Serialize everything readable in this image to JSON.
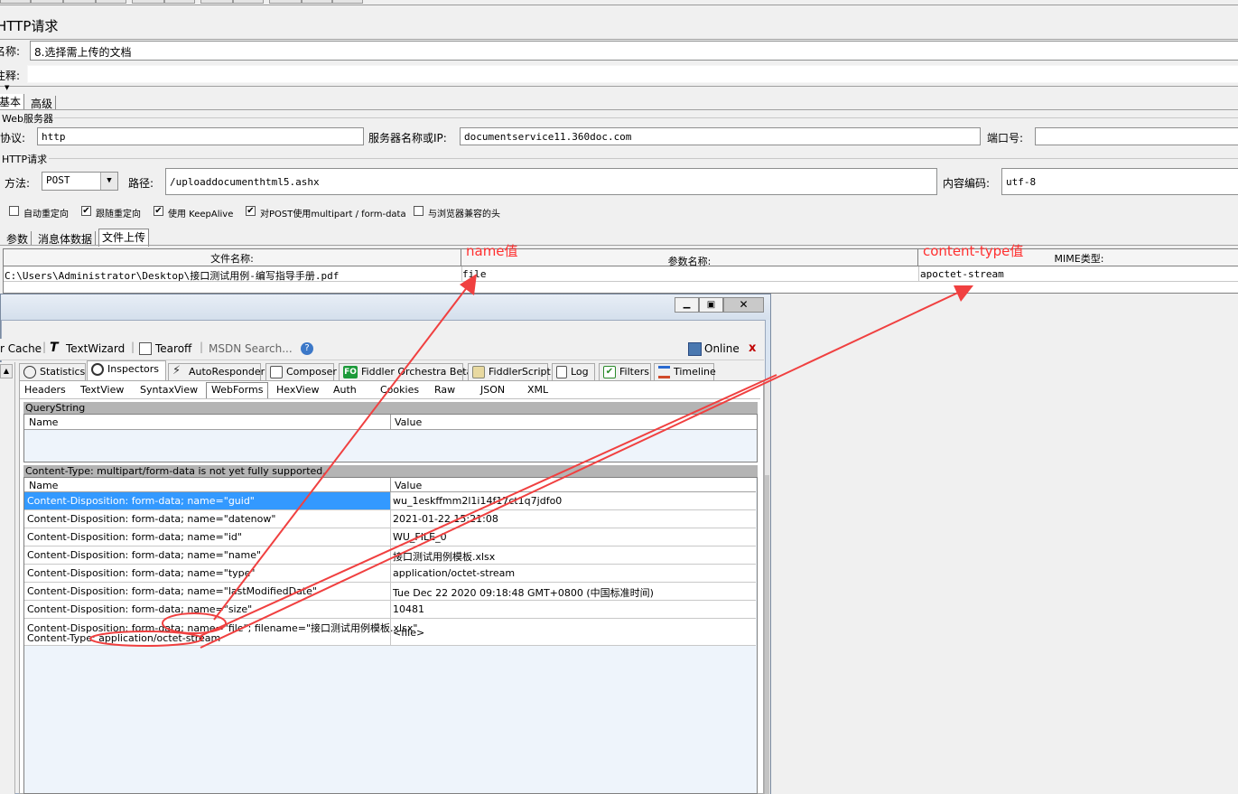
{
  "window_title": "HTTP请求",
  "name_label": "名称:",
  "name_value": "8.选择需上传的文档",
  "comment_label": "注释:",
  "tabs": [
    "基本",
    "高级"
  ],
  "web_server_group": "Web服务器",
  "protocol_label": "协议:",
  "protocol_value": "http",
  "server_label": "服务器名称或IP:",
  "server_value": "documentservice11.360doc.com",
  "port_label": "端口号:",
  "http_request_group": "HTTP请求",
  "method_label": "方法:",
  "method_value": "POST",
  "path_label": "路径:",
  "path_value": "/uploaddocumenthtml5.ashx",
  "encoding_label": "内容编码:",
  "encoding_value": "utf-8",
  "checkboxes": [
    {
      "label": "自动重定向",
      "checked": false
    },
    {
      "label": "跟随重定向",
      "checked": true
    },
    {
      "label": "使用 KeepAlive",
      "checked": true
    },
    {
      "label": "对POST使用multipart / form-data",
      "checked": true
    },
    {
      "label": "与浏览器兼容的头",
      "checked": false
    }
  ],
  "sub_tabs": [
    "参数",
    "消息体数据",
    "文件上传"
  ],
  "file_table": {
    "headers": [
      "文件名称:",
      "参数名称:",
      "MIME类型:"
    ],
    "row": [
      "C:\\Users\\Administrator\\Desktop\\接口测试用例-编写指导手册.pdf",
      "file",
      "apoctet-stream"
    ]
  },
  "annotations": {
    "name": "name值",
    "content_type": "content-type值"
  },
  "fiddler": {
    "toolbar": {
      "cache": "r Cache",
      "textwizard": "TextWizard",
      "tearoff": "Tearoff",
      "msdn_search": "MSDN Search...",
      "online": "Online",
      "close": "x"
    },
    "tabs": [
      "Statistics",
      "Inspectors",
      "AutoResponder",
      "Composer",
      "Fiddler Orchestra Beta",
      "FiddlerScript",
      "Log",
      "Filters",
      "Timeline"
    ],
    "fo_badge": "FO",
    "sub_tabs": [
      "Headers",
      "TextView",
      "SyntaxView",
      "WebForms",
      "HexView",
      "Auth",
      "Cookies",
      "Raw",
      "JSON",
      "XML"
    ],
    "querystring_title": "QueryString",
    "col_name": "Name",
    "col_value": "Value",
    "multipart_title": "Content-Type: multipart/form-data is not yet fully supported.",
    "rows": [
      {
        "name": "Content-Disposition: form-data; name=\"guid\"",
        "value": "wu_1eskffmm2l1i14f17ct1q7jdfo0"
      },
      {
        "name": "Content-Disposition: form-data; name=\"datenow\"",
        "value": "2021-01-22 15:21:08"
      },
      {
        "name": "Content-Disposition: form-data; name=\"id\"",
        "value": "WU_FILE_0"
      },
      {
        "name": "Content-Disposition: form-data; name=\"name\"",
        "value": "接口测试用例模板.xlsx"
      },
      {
        "name": "Content-Disposition: form-data; name=\"type\"",
        "value": "application/octet-stream"
      },
      {
        "name": "Content-Disposition: form-data; name=\"lastModifiedDate\"",
        "value": "Tue Dec 22 2020 09:18:48 GMT+0800 (中国标准时间)"
      },
      {
        "name": "Content-Disposition: form-data; name=\"size\"",
        "value": "10481"
      }
    ],
    "last_row": {
      "line1": "Content-Disposition: form-data; name=\"file\"; filename=\"接口测试用例模板.xlsx\"",
      "line2": "Content-Type: application/octet-stream",
      "value": "<file>"
    }
  }
}
